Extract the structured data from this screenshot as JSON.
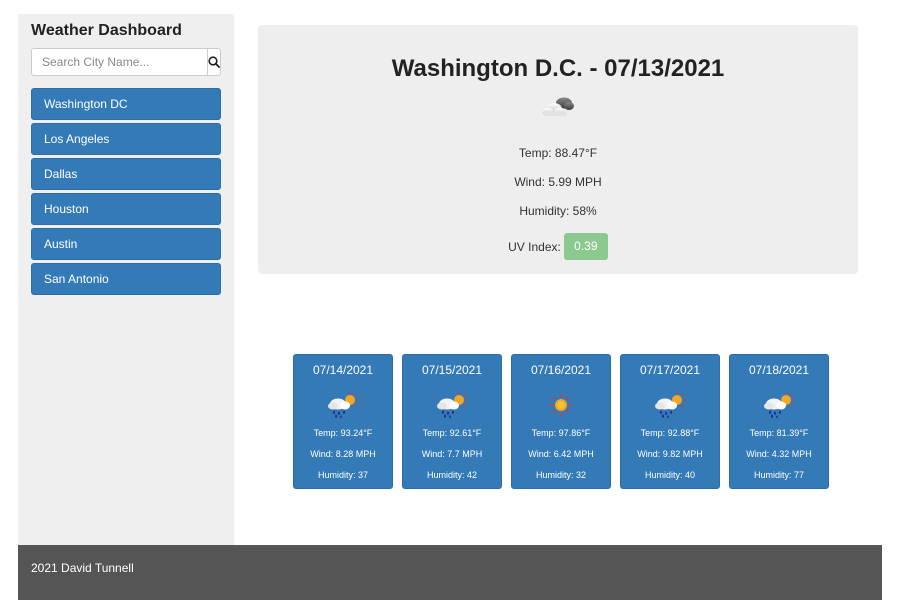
{
  "sidebar": {
    "title": "Weather Dashboard",
    "search_placeholder": "Search City Name...",
    "search_icon": "search-icon",
    "cities": [
      "Washington DC",
      "Los Angeles",
      "Dallas",
      "Houston",
      "Austin",
      "San Antonio"
    ]
  },
  "current": {
    "title": "Washington D.C. - 07/13/2021",
    "icon": "cloudy-icon",
    "temp": "Temp: 88.47°F",
    "wind": "Wind: 5.99 MPH",
    "humidity": "Humidity: 58%",
    "uv_label": "UV Index:",
    "uv_value": "0.39"
  },
  "forecast": [
    {
      "date": "07/14/2021",
      "icon": "rain-sun-icon",
      "temp": "Temp: 93.24°F",
      "wind": "Wind: 8.28 MPH",
      "humidity": "Humidity: 37"
    },
    {
      "date": "07/15/2021",
      "icon": "rain-sun-icon",
      "temp": "Temp: 92.61°F",
      "wind": "Wind: 7.7 MPH",
      "humidity": "Humidity: 42"
    },
    {
      "date": "07/16/2021",
      "icon": "sun-icon",
      "temp": "Temp: 97.86°F",
      "wind": "Wind: 6.42 MPH",
      "humidity": "Humidity: 32"
    },
    {
      "date": "07/17/2021",
      "icon": "rain-sun-icon",
      "temp": "Temp: 92.88°F",
      "wind": "Wind: 9.82 MPH",
      "humidity": "Humidity: 40"
    },
    {
      "date": "07/18/2021",
      "icon": "rain-sun-icon",
      "temp": "Temp: 81.39°F",
      "wind": "Wind: 4.32 MPH",
      "humidity": "Humidity: 77"
    }
  ],
  "footer": {
    "text": "2021 David Tunnell"
  },
  "colors": {
    "primary": "#337ab7",
    "panel": "#eeeeee",
    "uv_good": "#8bc98f",
    "footer": "#555555"
  }
}
